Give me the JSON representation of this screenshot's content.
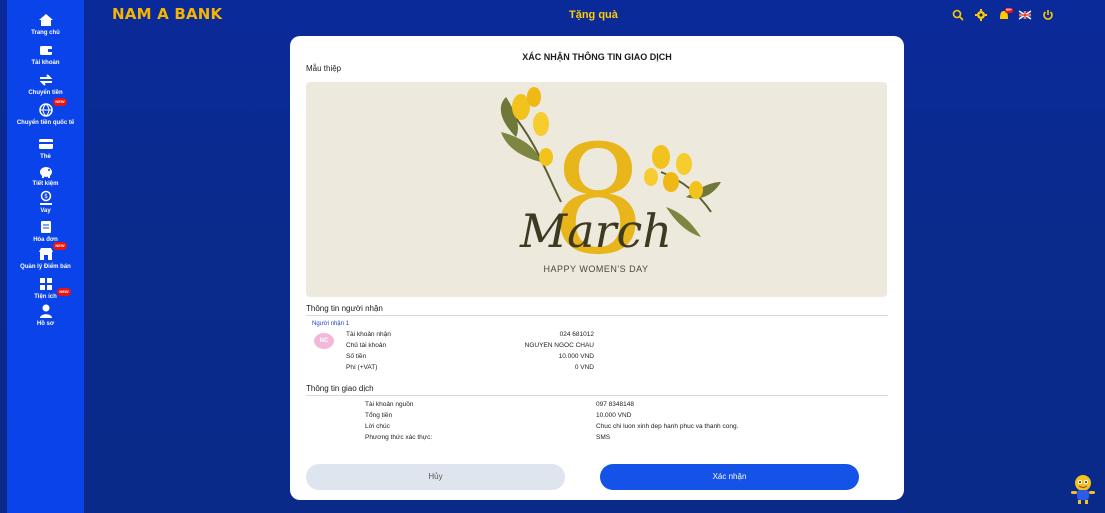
{
  "brand": "NAM A BANK",
  "page_title": "Tặng quà",
  "sidebar": {
    "items": [
      {
        "label": "Trang chủ",
        "icon": "home-icon"
      },
      {
        "label": "Tài khoản",
        "icon": "wallet-icon"
      },
      {
        "label": "Chuyển tiền",
        "icon": "transfer-icon"
      },
      {
        "label": "Chuyển tiền quốc tế",
        "icon": "globe-icon",
        "badge": "NEW"
      },
      {
        "label": "Thẻ",
        "icon": "card-icon"
      },
      {
        "label": "Tiết kiệm",
        "icon": "piggy-bank-icon"
      },
      {
        "label": "Vay",
        "icon": "loan-icon"
      },
      {
        "label": "Hóa đơn",
        "icon": "bill-icon"
      },
      {
        "label": "Quản lý Điểm bán",
        "icon": "store-icon",
        "badge": "NEW"
      },
      {
        "label": "Tiện ích",
        "icon": "grid-icon",
        "badge": "NEW"
      },
      {
        "label": "Hồ sơ",
        "icon": "profile-icon"
      }
    ]
  },
  "header_icons": [
    "search-icon",
    "gear-icon",
    "notification-icon",
    "language-flag-icon",
    "power-icon"
  ],
  "notification_count": "99+",
  "modal": {
    "title": "XÁC NHẬN THÔNG TIN GIAO DỊCH",
    "card_label": "Mẫu thiệp",
    "card": {
      "number": "8",
      "script": "March",
      "caption": "HAPPY WOMEN'S DAY"
    },
    "recipient_section": "Thông tin người nhận",
    "recipient_heading": "Người nhận 1",
    "avatar_initials": "NC",
    "recipient_rows": [
      {
        "label": "Tài khoản nhận",
        "value": "024 681012"
      },
      {
        "label": "Chủ tài khoản",
        "value": "NGUYEN NGOC CHAU"
      },
      {
        "label": "Số tiền",
        "value": "10.000 VND"
      },
      {
        "label": "Phí (+VAT)",
        "value": "0 VND"
      }
    ],
    "transaction_section": "Thông tin giao dịch",
    "transaction_rows": [
      {
        "label": "Tài khoản nguồn",
        "value": "097 8348148"
      },
      {
        "label": "Tổng tiền",
        "value": "10.000 VND"
      },
      {
        "label": "Lời chúc",
        "value": "Chuc chi luon xinh dep hanh phuc va thanh cong."
      },
      {
        "label": "Phương thức xác thực:",
        "value": "SMS"
      }
    ],
    "cancel_label": "Hủy",
    "confirm_label": "Xác nhận"
  },
  "colors": {
    "background": "#0b2a9a",
    "sidebar": "#0b43ea",
    "brand": "#f5b400",
    "title": "#ffcc00",
    "primary_button": "#1552e8",
    "secondary_button": "#dfe5ee",
    "card_bg": "#ede9dc",
    "card_gold": "#e8b51a"
  }
}
